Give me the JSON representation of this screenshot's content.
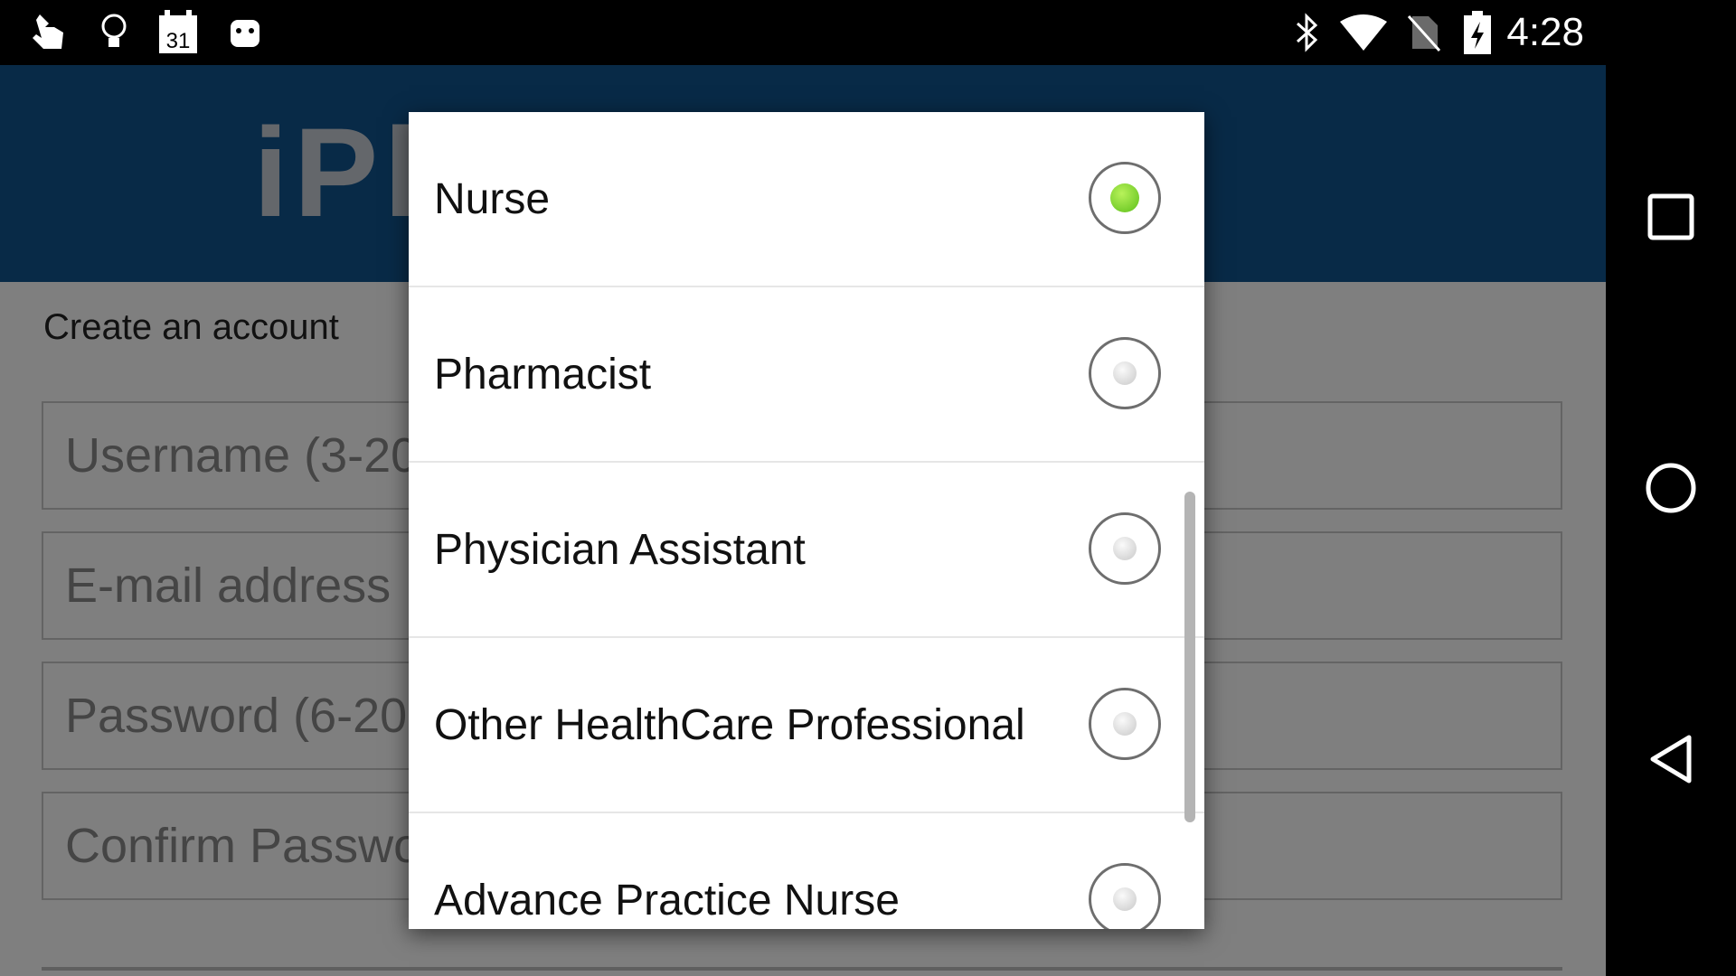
{
  "status_bar": {
    "time": "4:28",
    "calendar_day": "31",
    "left_icons": [
      "touch-icon",
      "lightbulb-icon",
      "calendar-icon",
      "android-robot-icon"
    ],
    "right_icons": [
      "bluetooth-icon",
      "wifi-icon",
      "no-sim-icon",
      "battery-charging-icon"
    ]
  },
  "app": {
    "logo_text": "iPharmacy",
    "create_title": "Create an account",
    "fields": {
      "username_placeholder": "Username (3-20",
      "email_placeholder": "E-mail address",
      "password_placeholder": "Password (6-20",
      "confirm_placeholder": "Confirm Passwo"
    }
  },
  "dialog": {
    "options": [
      {
        "label": "Nurse",
        "checked": true
      },
      {
        "label": "Pharmacist",
        "checked": false
      },
      {
        "label": "Physician Assistant",
        "checked": false
      },
      {
        "label": "Other HealthCare Professional",
        "checked": false
      },
      {
        "label": "Advance Practice Nurse",
        "checked": false
      }
    ],
    "selected_color": "#6cc924"
  },
  "nav_bar": {
    "buttons": [
      "recents-square-icon",
      "home-circle-icon",
      "back-triangle-icon"
    ]
  }
}
